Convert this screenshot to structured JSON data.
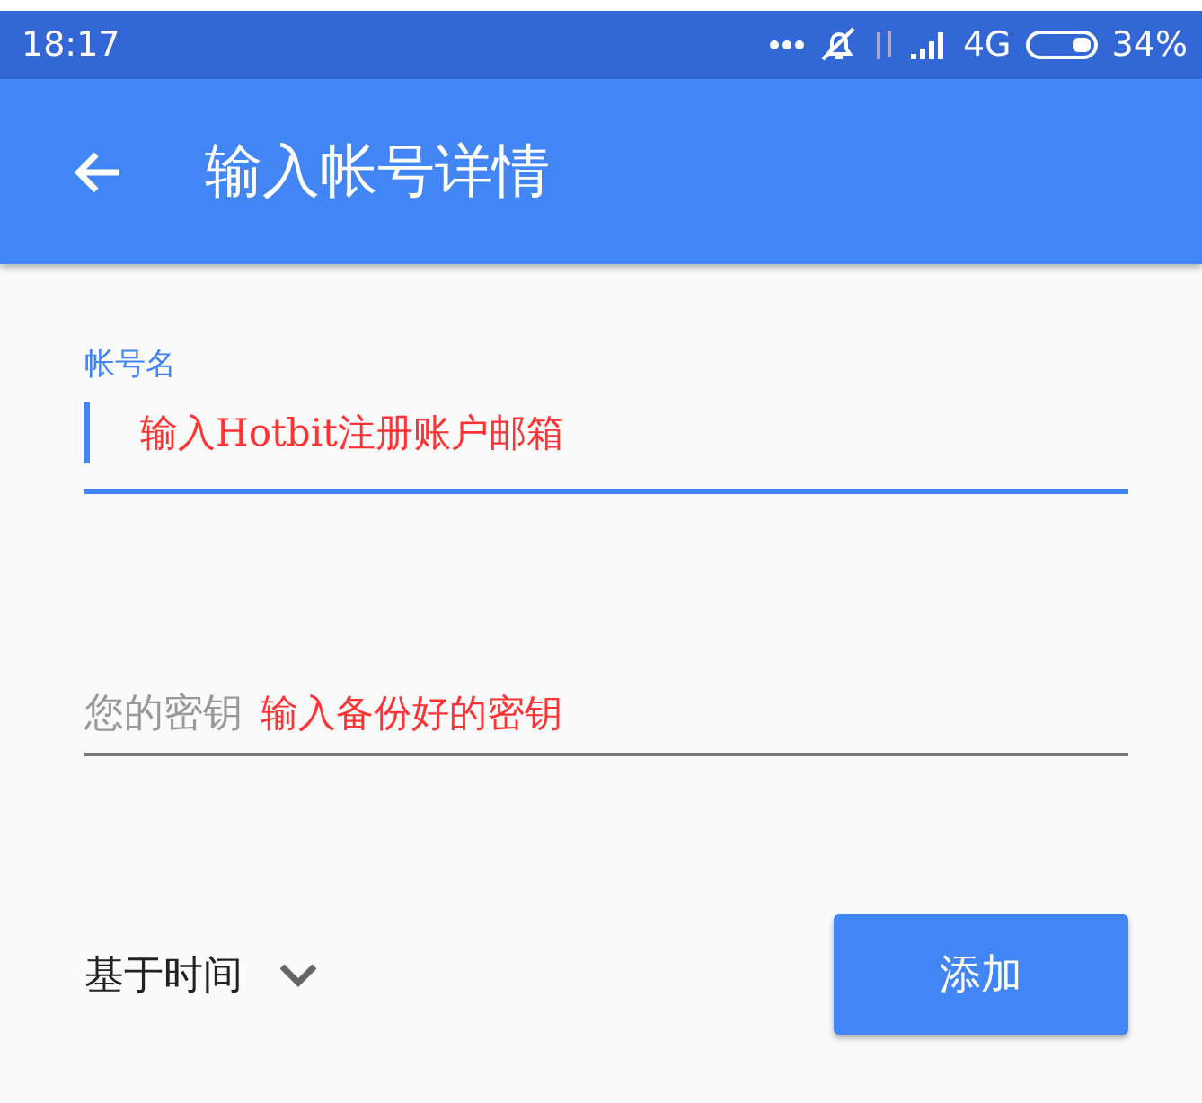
{
  "status_bar": {
    "time": "18:17",
    "network": "4G",
    "battery": "34%"
  },
  "app_bar": {
    "title": "输入帐号详情"
  },
  "fields": [
    {
      "label": "帐号名",
      "focused": true,
      "annotation": "输入Hotbit注册账户邮箱"
    },
    {
      "label": "您的密钥",
      "focused": false,
      "annotation": "输入备份好的密钥"
    }
  ],
  "type_dropdown": {
    "value": "基于时间"
  },
  "buttons": [
    "添加"
  ]
}
